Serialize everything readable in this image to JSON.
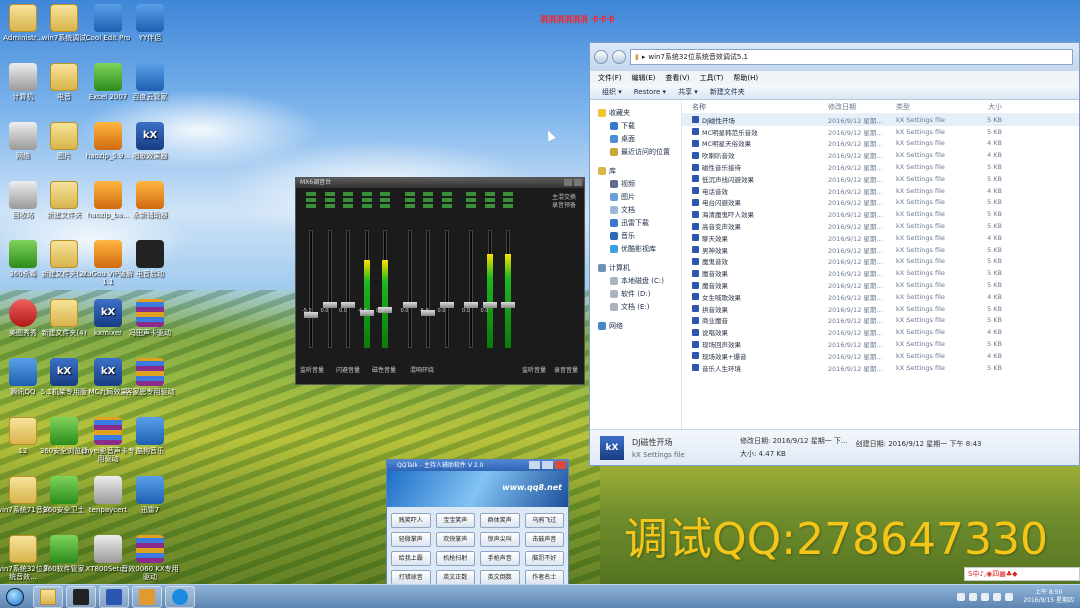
{
  "desktop": {
    "red_text": "消消消消消消 卡卡卡",
    "icons": [
      {
        "label": "Administr...",
        "kind": "folder"
      },
      {
        "label": "win7系统调试",
        "kind": "folder"
      },
      {
        "label": "Cool Edit Pro",
        "kind": "blue"
      },
      {
        "label": "YY伴侣",
        "kind": "blue"
      },
      {
        "label": "计算机",
        "kind": "grey"
      },
      {
        "label": "电音",
        "kind": "folder"
      },
      {
        "label": "Excel 2007",
        "kind": "green"
      },
      {
        "label": "百度云管家",
        "kind": "blue"
      },
      {
        "label": "网络",
        "kind": "grey"
      },
      {
        "label": "图片",
        "kind": "folder"
      },
      {
        "label": "haozip_5.9...",
        "kind": "orange"
      },
      {
        "label": "唱歌效果器",
        "kind": "kx"
      },
      {
        "label": "回收站",
        "kind": "grey"
      },
      {
        "label": "新建文件夹",
        "kind": "folder"
      },
      {
        "label": "haozip_ba...",
        "kind": "orange"
      },
      {
        "label": "永新辅助器",
        "kind": "orange"
      },
      {
        "label": "360杀毒",
        "kind": "green"
      },
      {
        "label": "新建文件夹(2)",
        "kind": "folder"
      },
      {
        "label": "KuGou VIP破解1.1",
        "kind": "orange"
      },
      {
        "label": "电音启动",
        "kind": "dark"
      },
      {
        "label": "美图秀秀",
        "kind": "red"
      },
      {
        "label": "新建文件夹(4)",
        "kind": "folder"
      },
      {
        "label": "kxmixer",
        "kind": "kx"
      },
      {
        "label": "冯田声卡驱动",
        "kind": "rar"
      },
      {
        "label": "腾讯QQ",
        "kind": "blue"
      },
      {
        "label": "5.1机架专用版",
        "kind": "kx"
      },
      {
        "label": "MC九局效果",
        "kind": "kx"
      },
      {
        "label": "客家思专用驱动",
        "kind": "rar"
      },
      {
        "label": "12",
        "kind": "folder"
      },
      {
        "label": "360安全浏览器",
        "kind": "green"
      },
      {
        "label": "chyei影音声卡专用驱动",
        "kind": "rar"
      },
      {
        "label": "酷狗音乐",
        "kind": "blue"
      },
      {
        "label": "win7系统71音效",
        "kind": "folder"
      },
      {
        "label": "360安全卫士",
        "kind": "green"
      },
      {
        "label": "tenpaycert",
        "kind": "grey"
      },
      {
        "label": "迅雷7",
        "kind": "blue"
      },
      {
        "label": "win7系统32位系统音效...",
        "kind": "folder"
      },
      {
        "label": "360软件管家",
        "kind": "green"
      },
      {
        "label": "XT800Setu...",
        "kind": "grey"
      },
      {
        "label": "音效0060 KX专用驱动",
        "kind": "rar"
      }
    ]
  },
  "explorer": {
    "address": "win7系统32位系统音效调试5.1",
    "menu": [
      "文件(F)",
      "编辑(E)",
      "查看(V)",
      "工具(T)",
      "帮助(H)"
    ],
    "toolbar": [
      "组织 ▾",
      "Restore ▾",
      "共享 ▾",
      "新建文件夹"
    ],
    "nav": {
      "favorites": "收藏夹",
      "fav_items": [
        "下载",
        "桌面",
        "最近访问的位置"
      ],
      "library": "库",
      "lib_items": [
        "视频",
        "图片",
        "文档",
        "迅雷下载",
        "音乐",
        "优酷影视库"
      ],
      "computer": "计算机",
      "comp_items": [
        "本地磁盘 (C:)",
        "软件 (D:)",
        "文档 (E:)"
      ],
      "network": "网络"
    },
    "columns": [
      "名称",
      "修改日期",
      "类型",
      "大小"
    ],
    "files": [
      {
        "name": "DJ磁性开场",
        "date": "2016/9/12 星期...",
        "type": "kX Settings file",
        "size": "5 KB"
      },
      {
        "name": "MC明星韩范乐音效",
        "date": "2016/9/12 星期...",
        "type": "kX Settings file",
        "size": "5 KB"
      },
      {
        "name": "MC明星天俗效果",
        "date": "2016/9/12 星期...",
        "type": "kX Settings file",
        "size": "4 KB"
      },
      {
        "name": "吹喇叭音效",
        "date": "2016/9/12 星期...",
        "type": "kX Settings file",
        "size": "4 KB"
      },
      {
        "name": "磁性音乐接待",
        "date": "2016/9/12 星期...",
        "type": "kX Settings file",
        "size": "5 KB"
      },
      {
        "name": "低沉声线闪避效果",
        "date": "2016/9/12 星期...",
        "type": "kX Settings file",
        "size": "5 KB"
      },
      {
        "name": "电话音效",
        "date": "2016/9/12 星期...",
        "type": "kX Settings file",
        "size": "4 KB"
      },
      {
        "name": "电台闪避效果",
        "date": "2016/9/12 星期...",
        "type": "kX Settings file",
        "size": "5 KB"
      },
      {
        "name": "海清魔鬼吓人效果",
        "date": "2016/9/12 星期...",
        "type": "kX Settings file",
        "size": "5 KB"
      },
      {
        "name": "高音变声效果",
        "date": "2016/9/12 星期...",
        "type": "kX Settings file",
        "size": "5 KB"
      },
      {
        "name": "聊天效果",
        "date": "2016/9/12 星期...",
        "type": "kX Settings file",
        "size": "4 KB"
      },
      {
        "name": "男神效果",
        "date": "2016/9/12 星期...",
        "type": "kX Settings file",
        "size": "5 KB"
      },
      {
        "name": "魔鬼音效",
        "date": "2016/9/12 星期...",
        "type": "kX Settings file",
        "size": "5 KB"
      },
      {
        "name": "魔音效果",
        "date": "2016/9/12 星期...",
        "type": "kX Settings file",
        "size": "5 KB"
      },
      {
        "name": "魔音效果",
        "date": "2016/9/12 星期...",
        "type": "kX Settings file",
        "size": "5 KB"
      },
      {
        "name": "女生喊歌效果",
        "date": "2016/9/12 星期...",
        "type": "kX Settings file",
        "size": "4 KB"
      },
      {
        "name": "拱音效果",
        "date": "2016/9/12 星期...",
        "type": "kX Settings file",
        "size": "5 KB"
      },
      {
        "name": "商业魔音",
        "date": "2016/9/12 星期...",
        "type": "kX Settings file",
        "size": "5 KB"
      },
      {
        "name": "说唱效果",
        "date": "2016/9/12 星期...",
        "type": "kX Settings file",
        "size": "4 KB"
      },
      {
        "name": "现场回声效果",
        "date": "2016/9/12 星期...",
        "type": "kX Settings file",
        "size": "5 KB"
      },
      {
        "name": "现场效果+爆音",
        "date": "2016/9/12 星期...",
        "type": "kX Settings file",
        "size": "4 KB"
      },
      {
        "name": "音乐人生环境",
        "date": "2016/9/12 星期...",
        "type": "kX Settings file",
        "size": "5 KB"
      }
    ],
    "status": {
      "name": "DJ磁性开场",
      "type": "kX Settings file",
      "modified_label": "修改日期: 2016/9/12 星期一 下...",
      "created_label": "创建日期: 2016/9/12 星期一 下午 8:43",
      "size_label": "大小: 4.47 KB"
    }
  },
  "mixer": {
    "title": "MX6调音台",
    "right_labels": [
      "主混交换",
      "录音预备"
    ],
    "bottom_labels": [
      "监听音量",
      "闪避音量",
      "磁性音量",
      "混响环绕",
      "监听音量",
      "录音音量"
    ],
    "channel_values": [
      "-5.2",
      "0.0",
      "0.0",
      "-6.9",
      "0.0",
      "0.0",
      "-5.3",
      "0.0",
      "0.0",
      "0.0"
    ],
    "meter_levels": [
      0,
      0,
      0,
      0.75,
      0.75,
      0,
      0,
      0,
      0,
      0.8,
      0.8
    ]
  },
  "qqtalk": {
    "title": "QQTalk - 主持人辅助软件 V 2.0",
    "banner_url": "www.qq8.net",
    "buttons": [
      "贱笑吓人",
      "宝宝笑声",
      "群体笑声",
      "乌鸦飞过",
      "轻微掌声",
      "欢快掌声",
      "惊声尖叫",
      "击鼓声音",
      "给我上霸",
      "机枪扫射",
      "手枪声音",
      "脑罚不好",
      "打错球音",
      "英文正数",
      "英文倒数",
      "作者名士"
    ]
  },
  "watermark": "调试QQ:278647330",
  "ime": "S中♪,◉四▦♣◆",
  "taskbar": {
    "apps": [
      "explorer",
      "prof-essor",
      "kxmixer",
      "tools",
      "kugou"
    ],
    "clock_time": "上午 8:50",
    "clock_date": "2016/9/15 星期四"
  }
}
